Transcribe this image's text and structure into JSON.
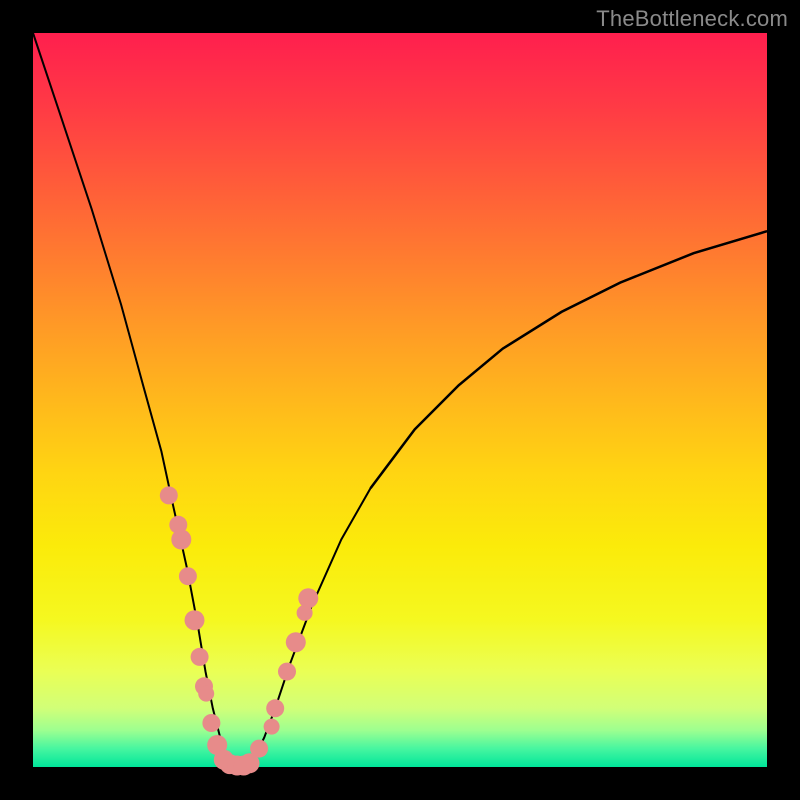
{
  "watermark": "TheBottleneck.com",
  "colors": {
    "frame_background": "#000000",
    "gradient_top": "#ff1f4e",
    "gradient_bottom": "#00e59a",
    "curve": "#000000",
    "marker": "#e78b8a",
    "watermark_text": "#8a8a8a"
  },
  "chart_data": {
    "type": "line",
    "title": "",
    "xlabel": "",
    "ylabel": "",
    "xlim": [
      0,
      100
    ],
    "ylim": [
      0,
      100
    ],
    "notes": "V-shaped bottleneck curve. y represents bottleneck severity (0 at valley = balanced, 100 at top = severe). Background gradient maps high y to red, low y to green. Two branches: steep left branch descending to a minimum near x≈28 (y=0), and a shallower right branch rising toward y≈73 at x=100. Salmon circular markers cluster around the valley on both branches between roughly 35% and 0% severity.",
    "x": [
      0,
      4,
      8,
      12,
      15,
      17.5,
      19,
      21,
      22.5,
      23.5,
      24.5,
      25.5,
      26.3,
      27,
      28,
      29,
      30.5,
      31.5,
      33,
      35,
      38,
      42,
      46,
      52,
      58,
      64,
      72,
      80,
      90,
      100
    ],
    "y_curve": [
      100,
      88,
      76,
      63,
      52,
      43,
      36,
      27,
      19,
      13,
      8,
      4,
      1.5,
      0.3,
      0,
      0.3,
      2,
      4,
      8,
      14,
      22,
      31,
      38,
      46,
      52,
      57,
      62,
      66,
      70,
      73
    ],
    "series": [
      {
        "name": "left_markers",
        "x": [
          18.5,
          19.8,
          20.2,
          21.1,
          22.0,
          22.7,
          23.3,
          23.6,
          24.3,
          25.1,
          26.0
        ],
        "y": [
          37,
          33,
          31,
          26,
          20,
          15,
          11,
          10,
          6,
          3,
          1
        ],
        "r": [
          9,
          9,
          10,
          9,
          10,
          9,
          9,
          8,
          9,
          10,
          10
        ]
      },
      {
        "name": "bottom_markers",
        "x": [
          26.8,
          27.8,
          28.7,
          29.5
        ],
        "y": [
          0.4,
          0.2,
          0.2,
          0.5
        ],
        "r": [
          10,
          10,
          10,
          10
        ]
      },
      {
        "name": "right_markers",
        "x": [
          30.8,
          32.5,
          33.0,
          34.6,
          35.8,
          37.0,
          37.5
        ],
        "y": [
          2.5,
          5.5,
          8,
          13,
          17,
          21,
          23
        ],
        "r": [
          9,
          8,
          9,
          9,
          10,
          8,
          10
        ]
      }
    ]
  }
}
